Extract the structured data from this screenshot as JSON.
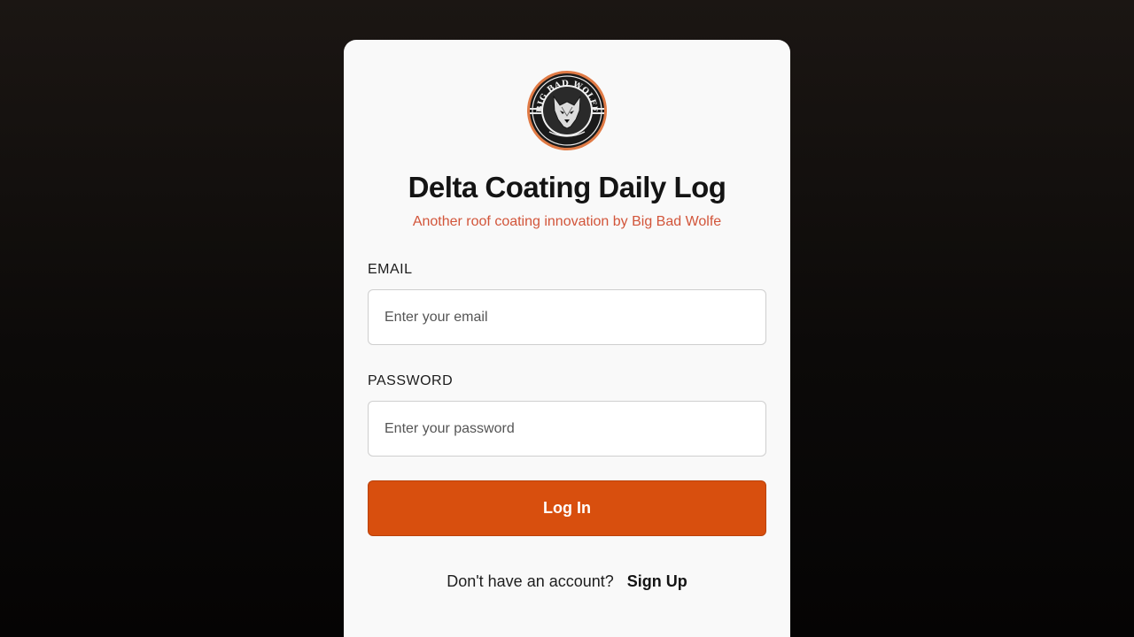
{
  "app": {
    "title": "Delta Coating Daily Log",
    "subtitle": "Another roof coating innovation by Big Bad Wolfe",
    "logo_text": "BIG BAD WOLFE"
  },
  "form": {
    "email_label": "EMAIL",
    "email_placeholder": "Enter your email",
    "email_value": "",
    "password_label": "PASSWORD",
    "password_placeholder": "Enter your password",
    "password_value": "",
    "submit_label": "Log In"
  },
  "footer": {
    "prompt": "Don't have an account?",
    "signup_label": "Sign Up"
  },
  "colors": {
    "accent": "#d84f0e",
    "subtitle": "#d2553a",
    "logo_ring": "#e07a45"
  },
  "icons": {
    "logo": "wolf-head-emblem"
  }
}
